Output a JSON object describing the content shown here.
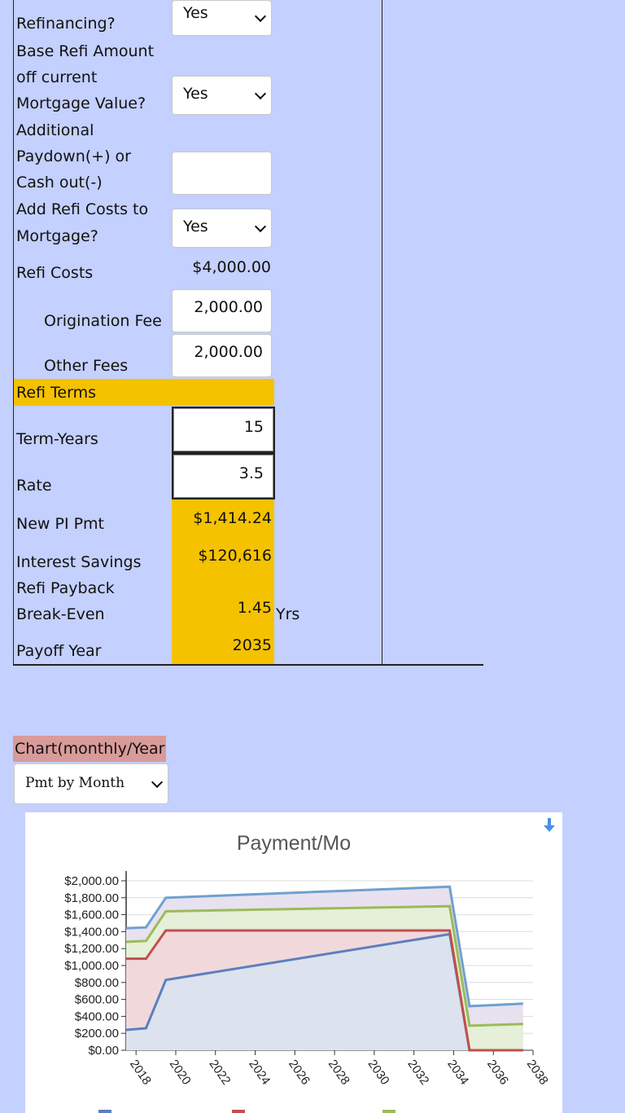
{
  "form": {
    "refinancing_label": "Refinancing?",
    "refinancing_value": "Yes",
    "base_refi_label_1": "Base Refi Amount",
    "base_refi_label_2": "off current",
    "base_refi_label_3": "Mortgage Value?",
    "base_refi_value": "Yes",
    "paydown_label_1": "Additional",
    "paydown_label_2": "Paydown(+) or",
    "paydown_label_3": "Cash out(-)",
    "paydown_value": "",
    "add_costs_label_1": "Add Refi Costs to",
    "add_costs_label_2": "Mortgage?",
    "add_costs_value": "Yes",
    "refi_costs_label": "Refi Costs",
    "refi_costs_value": "$4,000.00",
    "origination_label": "Origination Fee",
    "origination_value": "2,000.00",
    "other_fees_label": "Other Fees",
    "other_fees_value": "2,000.00"
  },
  "terms": {
    "header": "Refi Terms",
    "term_years_label": "Term-Years",
    "term_years_value": "15",
    "rate_label": "Rate",
    "rate_value": "3.5",
    "new_pi_label": "New PI Pmt",
    "new_pi_value": "$1,414.24",
    "interest_savings_label": "Interest Savings",
    "interest_savings_value": "$120,616",
    "payback_label_1": "Refi Payback",
    "payback_label_2": "Break-Even",
    "payback_value": "1.45",
    "payback_unit": "Yrs",
    "payoff_label": "Payoff Year",
    "payoff_value": "2035"
  },
  "chart_controls": {
    "label": "Chart(monthly/Year",
    "select_value": "Pmt by Month"
  },
  "colors": {
    "background": "#c4d0fd",
    "highlight": "#f5c200",
    "chart_label_bg": "#d99a9a",
    "series_blue": "#5b7fbf",
    "series_red": "#c0504d",
    "series_green": "#9bbb59",
    "series_total": "#6fa0cf"
  },
  "icons": {
    "download": "download-arrow-icon"
  },
  "chart_data": {
    "type": "area",
    "title": "Payment/Mo",
    "xlabel": "",
    "ylabel": "",
    "xlim": [
      2017.5,
      2038
    ],
    "ylim": [
      0,
      2000
    ],
    "x_ticks": [
      2018,
      2020,
      2022,
      2024,
      2026,
      2028,
      2030,
      2032,
      2034,
      2036,
      2038
    ],
    "y_ticks": [
      0,
      200,
      400,
      600,
      800,
      1000,
      1200,
      1400,
      1600,
      1800,
      2000
    ],
    "y_tick_labels": [
      "$0.00",
      "$200.00",
      "$400.00",
      "$600.00",
      "$800.00",
      "$1,000.00",
      "$1,200.00",
      "$1,400.00",
      "$1,600.00",
      "$1,800.00",
      "$2,000.00"
    ],
    "grid": true,
    "legend": "bottom",
    "series": [
      {
        "x": [
          2017.5,
          2018.5,
          2019.5,
          2033.8,
          2034.8,
          2037.5
        ],
        "values": [
          240,
          260,
          830,
          1370,
          0,
          0
        ]
      },
      {
        "x": [
          2017.5,
          2018.5,
          2019.5,
          2033.8,
          2034.8,
          2037.5
        ],
        "values": [
          1080,
          1080,
          1414,
          1414,
          0,
          0
        ]
      },
      {
        "x": [
          2017.5,
          2018.5,
          2019.5,
          2033.8,
          2034.8,
          2037.5
        ],
        "values": [
          1280,
          1290,
          1640,
          1700,
          290,
          310
        ]
      },
      {
        "x": [
          2017.5,
          2018.5,
          2019.5,
          2033.8,
          2034.8,
          2037.5
        ],
        "values": [
          1440,
          1450,
          1800,
          1930,
          520,
          550
        ]
      }
    ]
  }
}
